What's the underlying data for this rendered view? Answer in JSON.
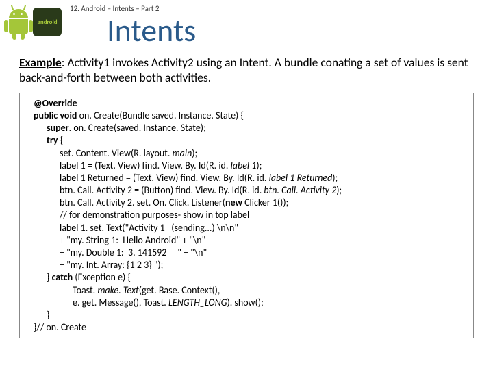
{
  "breadcrumb": "12. Android – Intents – Part 2",
  "title": "Intents",
  "logo_badge_text": "android",
  "example": {
    "label": "Example",
    "text": ": Activity1 invokes Activity2 using an Intent. A bundle conating a set of values is sent back-and-forth between both activities."
  },
  "code": {
    "l01": "@Override",
    "l02a": "public void",
    "l02b": " on. Create(Bundle saved. Instance. State) {",
    "l03a": "super",
    "l03b": ". on. Create(saved. Instance. State);",
    "l04a": "try",
    "l04b": " {",
    "l05a": "set. Content. View(R. layout. ",
    "l05b": "main",
    "l05c": ");",
    "l06a": "label 1 = (Text. View) find. View. By. Id(R. id. ",
    "l06b": "label 1",
    "l06c": ");",
    "l07a": "label 1 Returned = (Text. View) find. View. By. Id(R. id. ",
    "l07b": "label 1 Returned",
    "l07c": ");",
    "l08a": "btn. Call. Activity 2 = (Button) find. View. By. Id(R. id. ",
    "l08b": "btn. Call. Activity 2",
    "l08c": ");",
    "l09a": "btn. Call. Activity 2. set. On. Click. Listener(",
    "l09b": "new",
    "l09c": " Clicker 1());",
    "l10": "// for demonstration purposes- show in top label",
    "l11": "label 1. set. Text(\"Activity 1   (sending...) \\n\\n\"",
    "l12": "+ \"my. String 1:  Hello Android\" + \"\\n\"",
    "l13": "+ \"my. Double 1:  3. 141592     \" + \"\\n\"",
    "l14": "+ \"my. Int. Array: {1 2 3} \");",
    "l15a": "} ",
    "l15b": "catch",
    "l15c": " (Exception e) {",
    "l16a": "Toast. ",
    "l16b": "make. Text",
    "l16c": "(get. Base. Context(),",
    "l17a": "e. get. Message(), Toast. ",
    "l17b": "LENGTH_LONG",
    "l17c": "). show();",
    "l18": "}",
    "l19": "}// on. Create"
  }
}
